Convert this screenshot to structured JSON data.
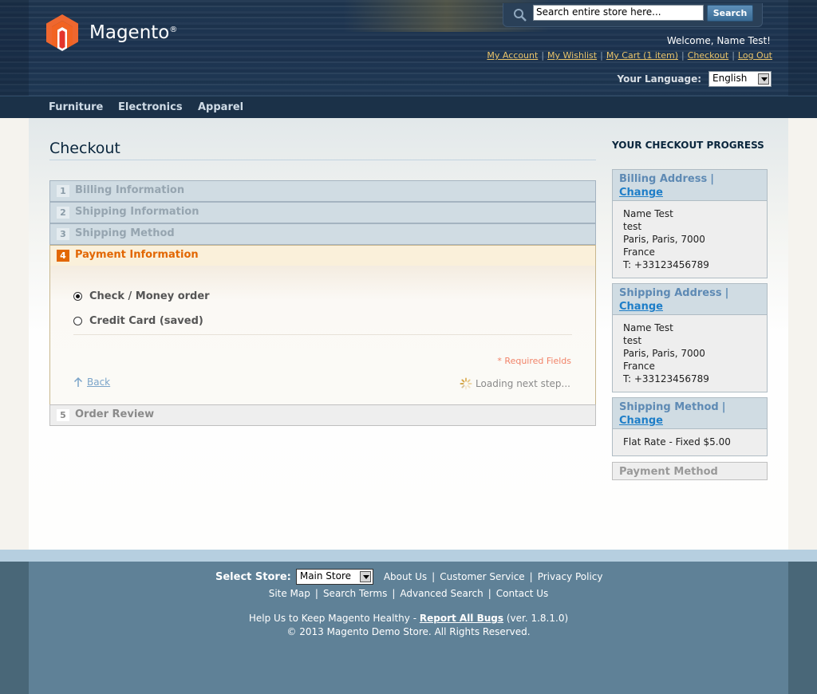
{
  "header": {
    "logo_text": "Magento",
    "logo_reg": "®",
    "search": {
      "placeholder": "Search entire store here...",
      "value": "Search entire store here...",
      "button": "Search"
    },
    "welcome": "Welcome, Name Test!",
    "links": [
      "My Account",
      "My Wishlist",
      "My Cart (1 item)",
      "Checkout",
      "Log Out"
    ],
    "language_label": "Your Language:",
    "language_value": "English"
  },
  "nav": [
    "Furniture",
    "Electronics",
    "Apparel"
  ],
  "checkout": {
    "title": "Checkout",
    "steps": [
      {
        "num": "1",
        "label": "Billing Information"
      },
      {
        "num": "2",
        "label": "Shipping Information"
      },
      {
        "num": "3",
        "label": "Shipping Method"
      },
      {
        "num": "4",
        "label": "Payment Information"
      },
      {
        "num": "5",
        "label": "Order Review"
      }
    ],
    "payment_options": [
      {
        "label": "Check / Money order",
        "checked": true
      },
      {
        "label": "Credit Card (saved)",
        "checked": false
      }
    ],
    "required_note": "* Required Fields",
    "back": "Back",
    "loading": "Loading next step..."
  },
  "progress": {
    "title": "YOUR CHECKOUT PROGRESS",
    "change": "Change",
    "sep": "|",
    "billing": {
      "head": "Billing Address",
      "lines": [
        "Name Test",
        "test",
        "Paris, Paris, 7000",
        "France",
        "T: +33123456789"
      ]
    },
    "shipping": {
      "head": "Shipping Address",
      "lines": [
        "Name Test",
        "test",
        "Paris, Paris, 7000",
        "France",
        "T: +33123456789"
      ]
    },
    "method": {
      "head": "Shipping Method",
      "lines": [
        "Flat Rate - Fixed $5.00"
      ]
    },
    "payment": {
      "head": "Payment Method"
    }
  },
  "footer": {
    "store_label": "Select Store:",
    "store_value": "Main Store",
    "links_row1": [
      "About Us",
      "Customer Service",
      "Privacy Policy"
    ],
    "links_row2": [
      "Site Map",
      "Search Terms",
      "Advanced Search",
      "Contact Us"
    ],
    "help_prefix": "Help Us to Keep Magento Healthy - ",
    "help_link": "Report All Bugs",
    "help_suffix": " (ver. 1.8.1.0)",
    "copyright": "© 2013 Magento Demo Store. All Rights Reserved."
  },
  "colors": {
    "accent_orange": "#e26703",
    "link_blue": "#1e7ec8",
    "header_dark": "#1f3650",
    "footer_blue": "#5f8197"
  }
}
